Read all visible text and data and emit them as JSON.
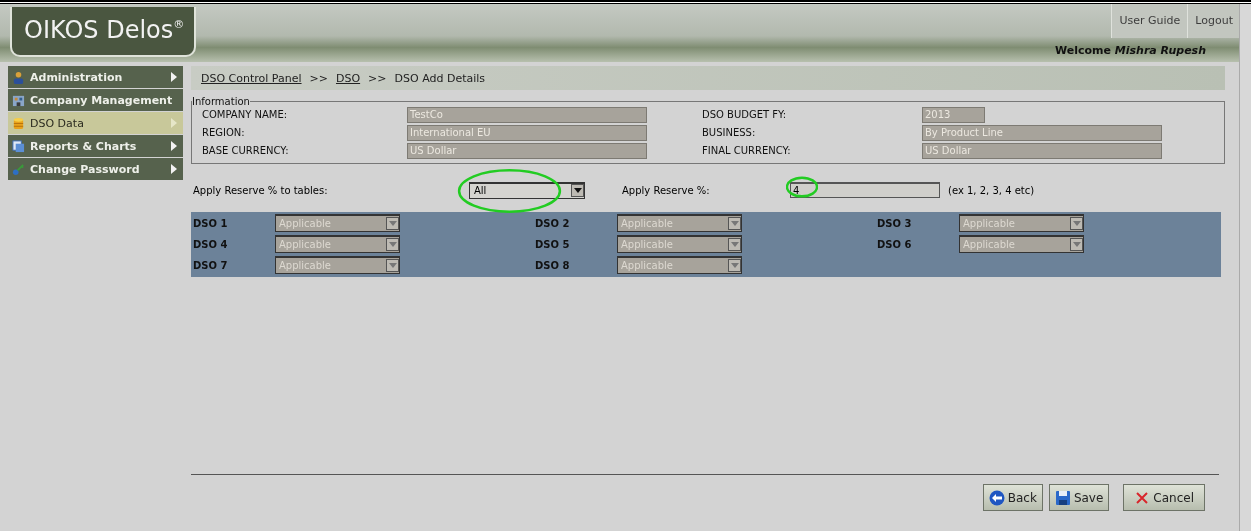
{
  "header": {
    "logo": "OIKOS Delos",
    "logo_mark": "®",
    "links": [
      "User Guide",
      "Logout"
    ],
    "welcome": "Welcome",
    "user": "Mishra Rupesh"
  },
  "sidebar": {
    "items": [
      {
        "label": "Administration",
        "kind": "admin",
        "selected": false
      },
      {
        "label": "Company Management",
        "kind": "company",
        "selected": false
      },
      {
        "label": "DSO Data",
        "kind": "data",
        "selected": true
      },
      {
        "label": "Reports & Charts",
        "kind": "reports",
        "selected": false
      },
      {
        "label": "Change Password",
        "kind": "password",
        "selected": false
      }
    ]
  },
  "breadcrumb": [
    {
      "label": "DSO Control Panel",
      "link": true
    },
    {
      "label": ">>",
      "link": false
    },
    {
      "label": "DSO",
      "link": true
    },
    {
      "label": ">>",
      "link": false
    },
    {
      "label": "DSO Add Details",
      "link": false
    }
  ],
  "information": {
    "legend": "Information",
    "fields": [
      {
        "label": "COMPANY NAME:",
        "value": "TestCo",
        "kind": "long"
      },
      {
        "label": "DSO BUDGET FY:",
        "value": "2013",
        "kind": "short"
      },
      {
        "label": "REGION:",
        "value": "International EU",
        "kind": "long"
      },
      {
        "label": "BUSINESS:",
        "value": "By Product Line",
        "kind": "long"
      },
      {
        "label": "BASE CURRENCY:",
        "value": "US Dollar",
        "kind": "long"
      },
      {
        "label": "FINAL CURRENCY:",
        "value": "US Dollar",
        "kind": "long"
      }
    ]
  },
  "reserve": {
    "tables_label": "Apply Reserve % to tables:",
    "tables_value": "All",
    "percent_label": "Apply Reserve %:",
    "percent_value": "4",
    "hint": "(ex 1, 2, 3, 4 etc)"
  },
  "dso_tables": [
    {
      "label": "DSO 1",
      "value": "Applicable",
      "disabled": true
    },
    {
      "label": "DSO 2",
      "value": "Applicable",
      "disabled": true
    },
    {
      "label": "DSO 3",
      "value": "Applicable",
      "disabled": true
    },
    {
      "label": "DSO 4",
      "value": "Applicable",
      "disabled": true
    },
    {
      "label": "DSO 5",
      "value": "Applicable",
      "disabled": true
    },
    {
      "label": "DSO 6",
      "value": "Applicable",
      "disabled": true
    },
    {
      "label": "DSO 7",
      "value": "Applicable",
      "disabled": true
    },
    {
      "label": "DSO 8",
      "value": "Applicable",
      "disabled": true
    }
  ],
  "buttons": [
    {
      "label": "Back",
      "kind": "back"
    },
    {
      "label": "Save",
      "kind": "save"
    },
    {
      "label": "Cancel",
      "kind": "cancel"
    }
  ]
}
